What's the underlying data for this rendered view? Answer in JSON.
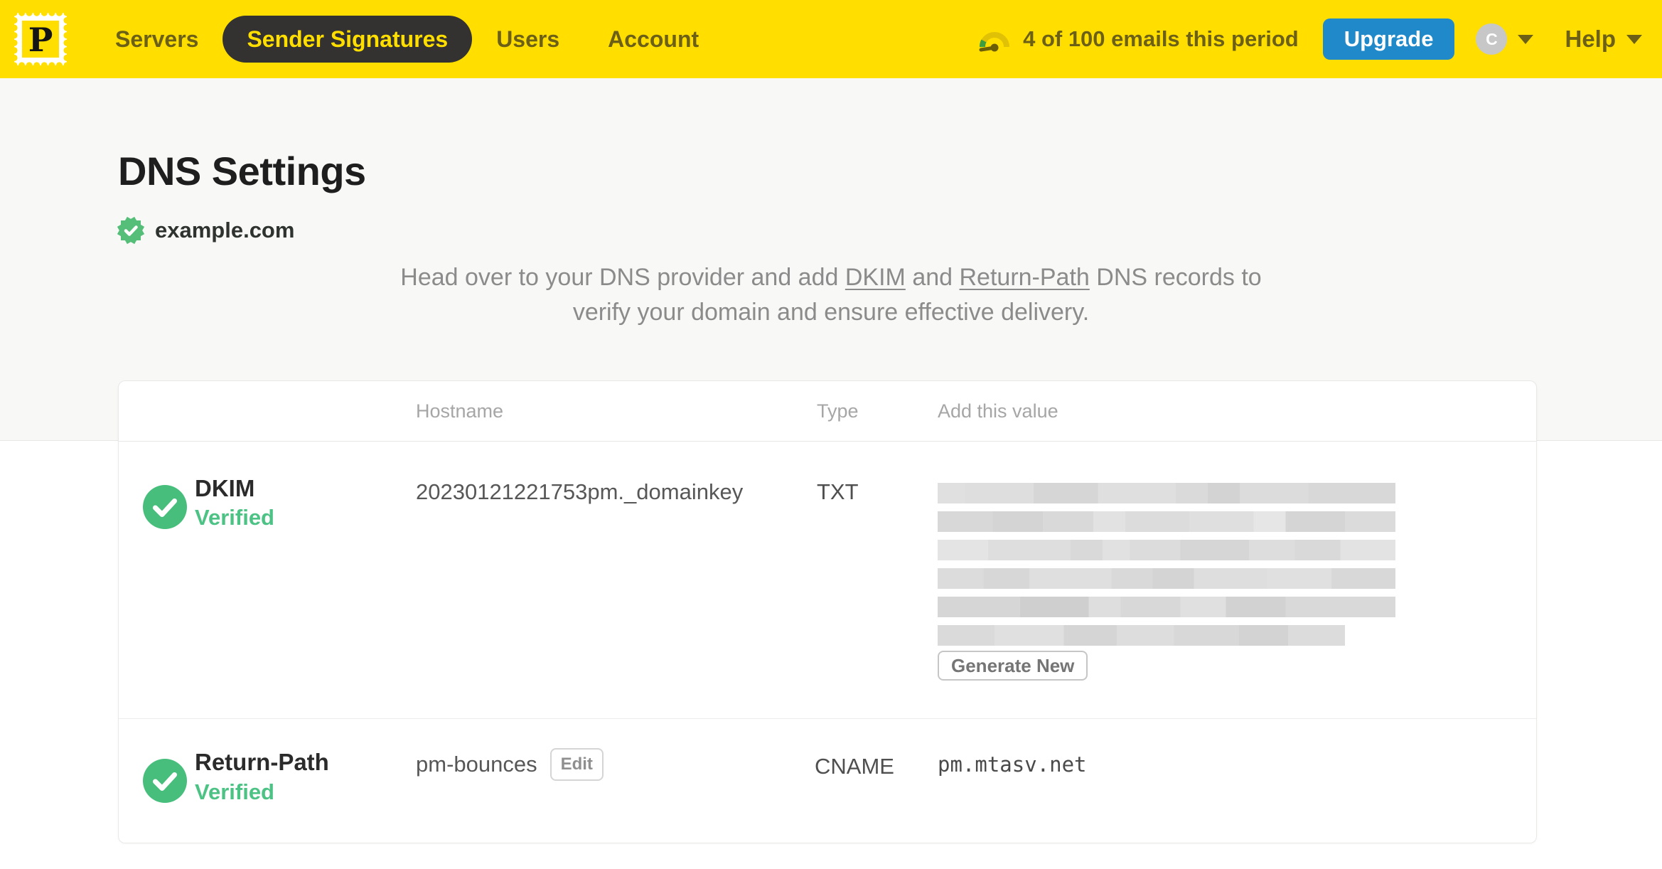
{
  "nav": {
    "logo_letter": "P",
    "items": [
      {
        "label": "Servers",
        "active": false
      },
      {
        "label": "Sender Signatures",
        "active": true
      },
      {
        "label": "Users",
        "active": false
      },
      {
        "label": "Account",
        "active": false
      }
    ],
    "usage_text": "4 of 100 emails this period",
    "upgrade_label": "Upgrade",
    "avatar_letter": "C",
    "help_label": "Help"
  },
  "page": {
    "title": "DNS Settings",
    "domain": "example.com",
    "intro": {
      "seg1": "Head over to your DNS provider and add ",
      "link1": "DKIM",
      "seg2": " and ",
      "link2": "Return-Path",
      "seg3": " DNS records to verify your domain and ensure effective delivery."
    }
  },
  "table": {
    "headers": {
      "hostname": "Hostname",
      "type": "Type",
      "value": "Add this value"
    },
    "rows": [
      {
        "name": "DKIM",
        "status": "Verified",
        "hostname": "20230121221753pm._domainkey",
        "type": "TXT",
        "value_redacted": true,
        "action_label": "Generate New"
      },
      {
        "name": "Return-Path",
        "status": "Verified",
        "hostname": "pm-bounces",
        "edit_label": "Edit",
        "type": "CNAME",
        "value": "pm.mtasv.net"
      }
    ]
  },
  "colors": {
    "brand_yellow": "#FFDE00",
    "nav_text_olive": "#6C6017",
    "accent_blue": "#1F89CA",
    "success_green": "#47BE7C",
    "verified_text_green": "#4CC285"
  }
}
